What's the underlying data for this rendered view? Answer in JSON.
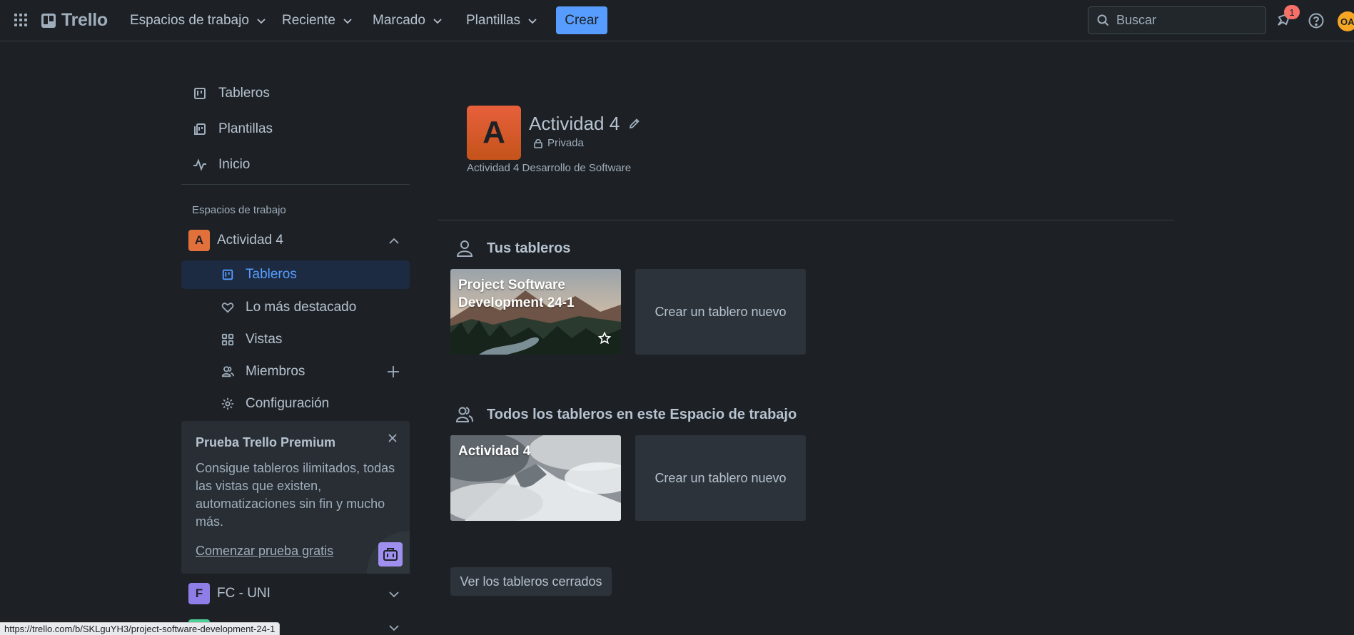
{
  "header": {
    "app_name": "Trello",
    "nav": [
      {
        "label": "Espacios de trabajo"
      },
      {
        "label": "Reciente"
      },
      {
        "label": "Marcado"
      },
      {
        "label": "Plantillas"
      }
    ],
    "create_label": "Crear",
    "search_placeholder": "Buscar",
    "notification_count": "1",
    "avatar_initials": "OA",
    "accent_color": "#579dff"
  },
  "sidebar": {
    "top_items": [
      {
        "label": "Tableros",
        "icon": "board-icon"
      },
      {
        "label": "Plantillas",
        "icon": "template-icon"
      },
      {
        "label": "Inicio",
        "icon": "pulse-icon"
      }
    ],
    "workspaces_heading": "Espacios de trabajo",
    "workspaces": [
      {
        "letter": "A",
        "name": "Actividad 4",
        "color": "#e2703a",
        "expanded": true
      },
      {
        "letter": "F",
        "name": "FC - UNI",
        "color": "#8f7ee7",
        "expanded": false
      }
    ],
    "sub_items": [
      {
        "label": "Tableros",
        "icon": "board-icon",
        "active": true
      },
      {
        "label": "Lo más destacado",
        "icon": "heart-icon"
      },
      {
        "label": "Vistas",
        "icon": "grid-icon"
      },
      {
        "label": "Miembros",
        "icon": "members-icon"
      },
      {
        "label": "Configuración",
        "icon": "gear-icon"
      }
    ],
    "promo": {
      "title": "Prueba Trello Premium",
      "body": "Consigue tableros ilimitados, todas las vistas que existen, automatizaciones sin fin y mucho más.",
      "link": "Comenzar prueba gratis"
    }
  },
  "workspace": {
    "logo_letter": "A",
    "title": "Actividad 4",
    "privacy": "Privada",
    "description": "Actividad 4 Desarrollo de Software"
  },
  "sections": {
    "your_boards": {
      "heading": "Tus tableros",
      "boards": [
        {
          "title": "Project Software Development 24-1"
        }
      ],
      "create_label": "Crear un tablero nuevo"
    },
    "all_boards": {
      "heading": "Todos los tableros en este Espacio de trabajo",
      "boards": [
        {
          "title": "Actividad 4"
        }
      ],
      "create_label": "Crear un tablero nuevo"
    }
  },
  "closed_boards_label": "Ver los tableros cerrados",
  "status_url": "https://trello.com/b/SKLguYH3/project-software-development-24-1"
}
